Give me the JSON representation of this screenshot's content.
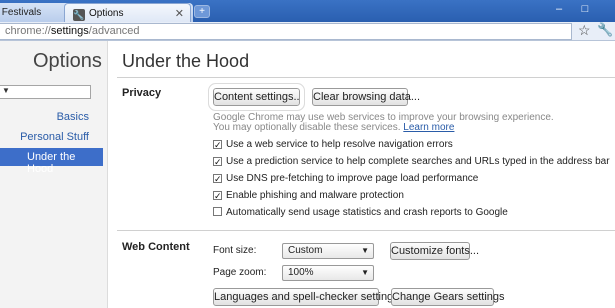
{
  "tabs": [
    {
      "label": "c Festivals",
      "active": false
    },
    {
      "label": "Options",
      "active": true
    }
  ],
  "omnibox": {
    "prefix": "chrome://",
    "host": "settings",
    "path": "/advanced"
  },
  "sidebar": {
    "title": "Options",
    "items": [
      {
        "label": "Basics"
      },
      {
        "label": "Personal Stuff"
      },
      {
        "label": "Under the Hood",
        "selected": true
      }
    ]
  },
  "main": {
    "title": "Under the Hood",
    "privacy": {
      "label": "Privacy",
      "content_settings_label": "Content settings...",
      "clear_browsing_label": "Clear browsing data...",
      "info_line1": "Google Chrome may use web services to improve your browsing experience.",
      "info_line2": "You may optionally disable these services.",
      "learn_more": "Learn more",
      "options": [
        {
          "label": "Use a web service to help resolve navigation errors",
          "checked": true
        },
        {
          "label": "Use a prediction service to help complete searches and URLs typed in the address bar",
          "checked": true
        },
        {
          "label": "Use DNS pre-fetching to improve page load performance",
          "checked": true
        },
        {
          "label": "Enable phishing and malware protection",
          "checked": true
        },
        {
          "label": "Automatically send usage statistics and crash reports to Google",
          "checked": false
        }
      ]
    },
    "web_content": {
      "label": "Web Content",
      "font_size_label": "Font size:",
      "font_size_value": "Custom",
      "customize_fonts_label": "Customize fonts...",
      "page_zoom_label": "Page zoom:",
      "page_zoom_value": "100%",
      "languages_label": "Languages and spell-checker settings...",
      "gears_label": "Change Gears settings"
    }
  },
  "colors": {
    "accent": "#3d6ec9",
    "titlebar": "#2a5fb0",
    "link": "#2a5ca8"
  }
}
